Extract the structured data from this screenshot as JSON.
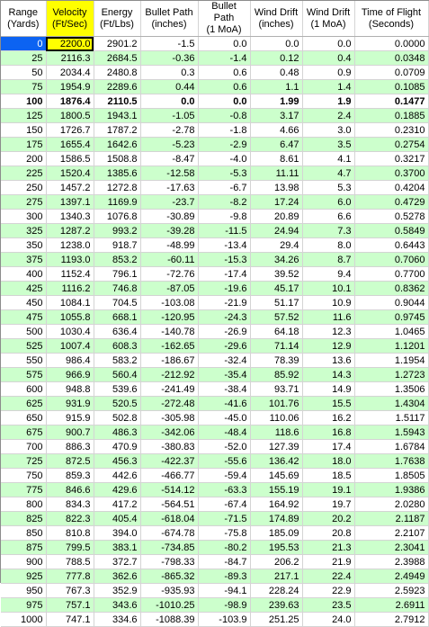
{
  "headers": [
    "Range\n(Yards)",
    "Velocity\n(Ft/Sec)",
    "Energy\n(Ft/Lbs)",
    "Bullet Path\n(inches)",
    "Bullet Path\n(1 MoA)",
    "Wind Drift\n(inches)",
    "Wind Drift\n(1 MoA)",
    "Time of Flight\n(Seconds)"
  ],
  "colors": {
    "row_alt": "#ccffcc",
    "highlight": "#ffff00",
    "selected_cell": "#0c63f2"
  },
  "rows": [
    [
      "0",
      "2200.0",
      "2901.2",
      "-1.5",
      "0.0",
      "0.0",
      "0.0",
      "0.0000"
    ],
    [
      "25",
      "2116.3",
      "2684.5",
      "-0.36",
      "-1.4",
      "0.12",
      "0.4",
      "0.0348"
    ],
    [
      "50",
      "2034.4",
      "2480.8",
      "0.3",
      "0.6",
      "0.48",
      "0.9",
      "0.0709"
    ],
    [
      "75",
      "1954.9",
      "2289.6",
      "0.44",
      "0.6",
      "1.1",
      "1.4",
      "0.1085"
    ],
    [
      "100",
      "1876.4",
      "2110.5",
      "0.0",
      "0.0",
      "1.99",
      "1.9",
      "0.1477"
    ],
    [
      "125",
      "1800.5",
      "1943.1",
      "-1.05",
      "-0.8",
      "3.17",
      "2.4",
      "0.1885"
    ],
    [
      "150",
      "1726.7",
      "1787.2",
      "-2.78",
      "-1.8",
      "4.66",
      "3.0",
      "0.2310"
    ],
    [
      "175",
      "1655.4",
      "1642.6",
      "-5.23",
      "-2.9",
      "6.47",
      "3.5",
      "0.2754"
    ],
    [
      "200",
      "1586.5",
      "1508.8",
      "-8.47",
      "-4.0",
      "8.61",
      "4.1",
      "0.3217"
    ],
    [
      "225",
      "1520.4",
      "1385.6",
      "-12.58",
      "-5.3",
      "11.11",
      "4.7",
      "0.3700"
    ],
    [
      "250",
      "1457.2",
      "1272.8",
      "-17.63",
      "-6.7",
      "13.98",
      "5.3",
      "0.4204"
    ],
    [
      "275",
      "1397.1",
      "1169.9",
      "-23.7",
      "-8.2",
      "17.24",
      "6.0",
      "0.4729"
    ],
    [
      "300",
      "1340.3",
      "1076.8",
      "-30.89",
      "-9.8",
      "20.89",
      "6.6",
      "0.5278"
    ],
    [
      "325",
      "1287.2",
      "993.2",
      "-39.28",
      "-11.5",
      "24.94",
      "7.3",
      "0.5849"
    ],
    [
      "350",
      "1238.0",
      "918.7",
      "-48.99",
      "-13.4",
      "29.4",
      "8.0",
      "0.6443"
    ],
    [
      "375",
      "1193.0",
      "853.2",
      "-60.11",
      "-15.3",
      "34.26",
      "8.7",
      "0.7060"
    ],
    [
      "400",
      "1152.4",
      "796.1",
      "-72.76",
      "-17.4",
      "39.52",
      "9.4",
      "0.7700"
    ],
    [
      "425",
      "1116.2",
      "746.8",
      "-87.05",
      "-19.6",
      "45.17",
      "10.1",
      "0.8362"
    ],
    [
      "450",
      "1084.1",
      "704.5",
      "-103.08",
      "-21.9",
      "51.17",
      "10.9",
      "0.9044"
    ],
    [
      "475",
      "1055.8",
      "668.1",
      "-120.95",
      "-24.3",
      "57.52",
      "11.6",
      "0.9745"
    ],
    [
      "500",
      "1030.4",
      "636.4",
      "-140.78",
      "-26.9",
      "64.18",
      "12.3",
      "1.0465"
    ],
    [
      "525",
      "1007.4",
      "608.3",
      "-162.65",
      "-29.6",
      "71.14",
      "12.9",
      "1.1201"
    ],
    [
      "550",
      "986.4",
      "583.2",
      "-186.67",
      "-32.4",
      "78.39",
      "13.6",
      "1.1954"
    ],
    [
      "575",
      "966.9",
      "560.4",
      "-212.92",
      "-35.4",
      "85.92",
      "14.3",
      "1.2723"
    ],
    [
      "600",
      "948.8",
      "539.6",
      "-241.49",
      "-38.4",
      "93.71",
      "14.9",
      "1.3506"
    ],
    [
      "625",
      "931.9",
      "520.5",
      "-272.48",
      "-41.6",
      "101.76",
      "15.5",
      "1.4304"
    ],
    [
      "650",
      "915.9",
      "502.8",
      "-305.98",
      "-45.0",
      "110.06",
      "16.2",
      "1.5117"
    ],
    [
      "675",
      "900.7",
      "486.3",
      "-342.06",
      "-48.4",
      "118.6",
      "16.8",
      "1.5943"
    ],
    [
      "700",
      "886.3",
      "470.9",
      "-380.83",
      "-52.0",
      "127.39",
      "17.4",
      "1.6784"
    ],
    [
      "725",
      "872.5",
      "456.3",
      "-422.37",
      "-55.6",
      "136.42",
      "18.0",
      "1.7638"
    ],
    [
      "750",
      "859.3",
      "442.6",
      "-466.77",
      "-59.4",
      "145.69",
      "18.5",
      "1.8505"
    ],
    [
      "775",
      "846.6",
      "429.6",
      "-514.12",
      "-63.3",
      "155.19",
      "19.1",
      "1.9386"
    ],
    [
      "800",
      "834.3",
      "417.2",
      "-564.51",
      "-67.4",
      "164.92",
      "19.7",
      "2.0280"
    ],
    [
      "825",
      "822.3",
      "405.4",
      "-618.04",
      "-71.5",
      "174.89",
      "20.2",
      "2.1187"
    ],
    [
      "850",
      "810.8",
      "394.0",
      "-674.78",
      "-75.8",
      "185.09",
      "20.8",
      "2.2107"
    ],
    [
      "875",
      "799.5",
      "383.1",
      "-734.85",
      "-80.2",
      "195.53",
      "21.3",
      "2.3041"
    ],
    [
      "900",
      "788.5",
      "372.7",
      "-798.33",
      "-84.7",
      "206.2",
      "21.9",
      "2.3988"
    ],
    [
      "925",
      "777.8",
      "362.6",
      "-865.32",
      "-89.3",
      "217.1",
      "22.4",
      "2.4949"
    ],
    [
      "950",
      "767.3",
      "352.9",
      "-935.93",
      "-94.1",
      "228.24",
      "22.9",
      "2.5923"
    ],
    [
      "975",
      "757.1",
      "343.6",
      "-1010.25",
      "-98.9",
      "239.63",
      "23.5",
      "2.6911"
    ],
    [
      "1000",
      "747.1",
      "334.6",
      "-1088.39",
      "-103.9",
      "251.25",
      "24.0",
      "2.7912"
    ]
  ]
}
